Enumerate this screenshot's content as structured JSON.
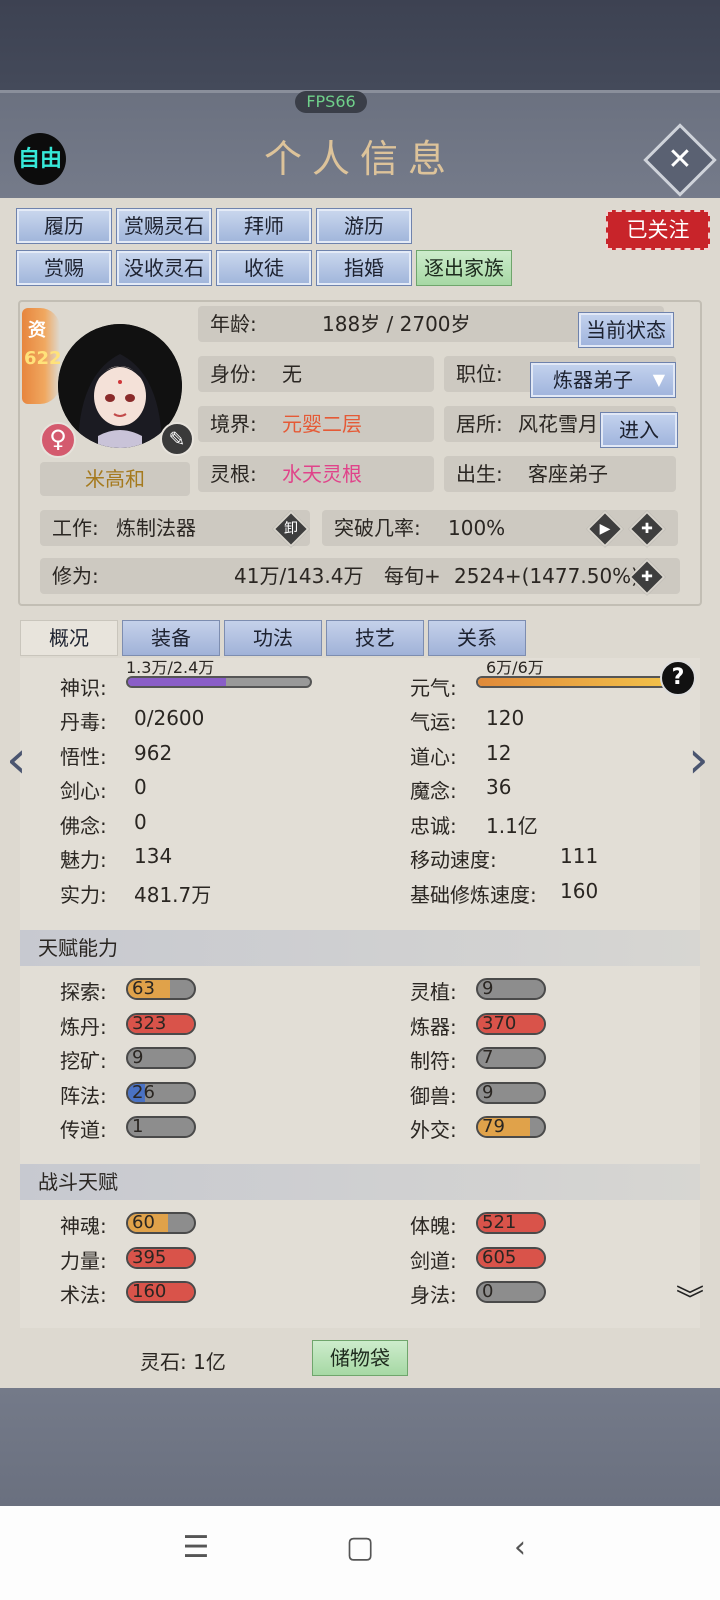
{
  "header": {
    "fps": "FPS66",
    "free_label": "自由",
    "title": "个人信息",
    "close_icon": "close-x-icon"
  },
  "actions_row1": [
    "履历",
    "赏赐灵石",
    "拜师",
    "游历"
  ],
  "actions_row2": [
    "赏赐",
    "没收灵石",
    "收徒",
    "指婚"
  ],
  "expel_label": "逐出家族",
  "follow_label": "已关注",
  "aptitude": {
    "label": "资",
    "value": "622"
  },
  "name": "米高和",
  "age": {
    "label": "年龄:",
    "value": "188岁 / 2700岁"
  },
  "status_button": "当前状态",
  "identity": {
    "label": "身份:",
    "value": "无"
  },
  "position": {
    "label": "职位:",
    "value": "炼器弟子"
  },
  "realm": {
    "label": "境界:",
    "value": "元婴二层"
  },
  "residence": {
    "label": "居所:",
    "value": "风花雪月"
  },
  "enter_button": "进入",
  "root": {
    "label": "灵根:",
    "value": "水天灵根"
  },
  "birth": {
    "label": "出生:",
    "value": "客座弟子"
  },
  "job": {
    "label": "工作:",
    "value": "炼制法器",
    "unload": "卸"
  },
  "breakthrough": {
    "label": "突破几率:",
    "value": "100%"
  },
  "cultivation": {
    "label": "修为:",
    "value": "41万/143.4万",
    "per_label": "每旬+",
    "per_value": "2524+(1477.50%)"
  },
  "tabs": [
    "概况",
    "装备",
    "功法",
    "技艺",
    "关系"
  ],
  "divine_sense": {
    "label": "神识:",
    "value": "1.3万/2.4万",
    "fraction": 0.54
  },
  "vitality": {
    "label": "元气:",
    "value": "6万/6万",
    "fraction": 1.0
  },
  "stats_left": [
    {
      "label": "丹毒:",
      "value": "0/2600"
    },
    {
      "label": "悟性:",
      "value": "962"
    },
    {
      "label": "剑心:",
      "value": "0"
    },
    {
      "label": "佛念:",
      "value": "0"
    },
    {
      "label": "魅力:",
      "value": "134"
    },
    {
      "label": "实力:",
      "value": "481.7万"
    }
  ],
  "stats_right": [
    {
      "label": "气运:",
      "value": "120"
    },
    {
      "label": "道心:",
      "value": "12"
    },
    {
      "label": "魔念:",
      "value": "36"
    },
    {
      "label": "忠诚:",
      "value": "1.1亿"
    },
    {
      "label": "移动速度:",
      "value": "111"
    },
    {
      "label": "基础修炼速度:",
      "value": "160"
    }
  ],
  "talent_title": "天赋能力",
  "talents_left": [
    {
      "label": "探索:",
      "value": "63",
      "fraction": 0.63,
      "color": "#e0a24a"
    },
    {
      "label": "炼丹:",
      "value": "323",
      "fraction": 1.0,
      "color": "#d9534a"
    },
    {
      "label": "挖矿:",
      "value": "9",
      "fraction": 0.0,
      "color": "#8d8d8d"
    },
    {
      "label": "阵法:",
      "value": "26",
      "fraction": 0.26,
      "color": "#4a72c4"
    },
    {
      "label": "传道:",
      "value": "1",
      "fraction": 0.0,
      "color": "#8d8d8d"
    }
  ],
  "talents_right": [
    {
      "label": "灵植:",
      "value": "9",
      "fraction": 0.0,
      "color": "#8d8d8d"
    },
    {
      "label": "炼器:",
      "value": "370",
      "fraction": 1.0,
      "color": "#d9534a"
    },
    {
      "label": "制符:",
      "value": "7",
      "fraction": 0.0,
      "color": "#8d8d8d"
    },
    {
      "label": "御兽:",
      "value": "9",
      "fraction": 0.0,
      "color": "#8d8d8d"
    },
    {
      "label": "外交:",
      "value": "79",
      "fraction": 0.79,
      "color": "#e0a24a"
    }
  ],
  "combat_title": "战斗天赋",
  "combat_left": [
    {
      "label": "神魂:",
      "value": "60",
      "fraction": 0.6,
      "color": "#e0a24a"
    },
    {
      "label": "力量:",
      "value": "395",
      "fraction": 1.0,
      "color": "#d9534a"
    },
    {
      "label": "术法:",
      "value": "160",
      "fraction": 1.0,
      "color": "#d9534a"
    }
  ],
  "combat_right": [
    {
      "label": "体魄:",
      "value": "521",
      "fraction": 1.0,
      "color": "#d9534a"
    },
    {
      "label": "剑道:",
      "value": "605",
      "fraction": 1.0,
      "color": "#d9534a"
    },
    {
      "label": "身法:",
      "value": "0",
      "fraction": 0.0,
      "color": "#8d8d8d"
    }
  ],
  "spirit_stones": "灵石: 1亿",
  "bag_button": "储物袋"
}
